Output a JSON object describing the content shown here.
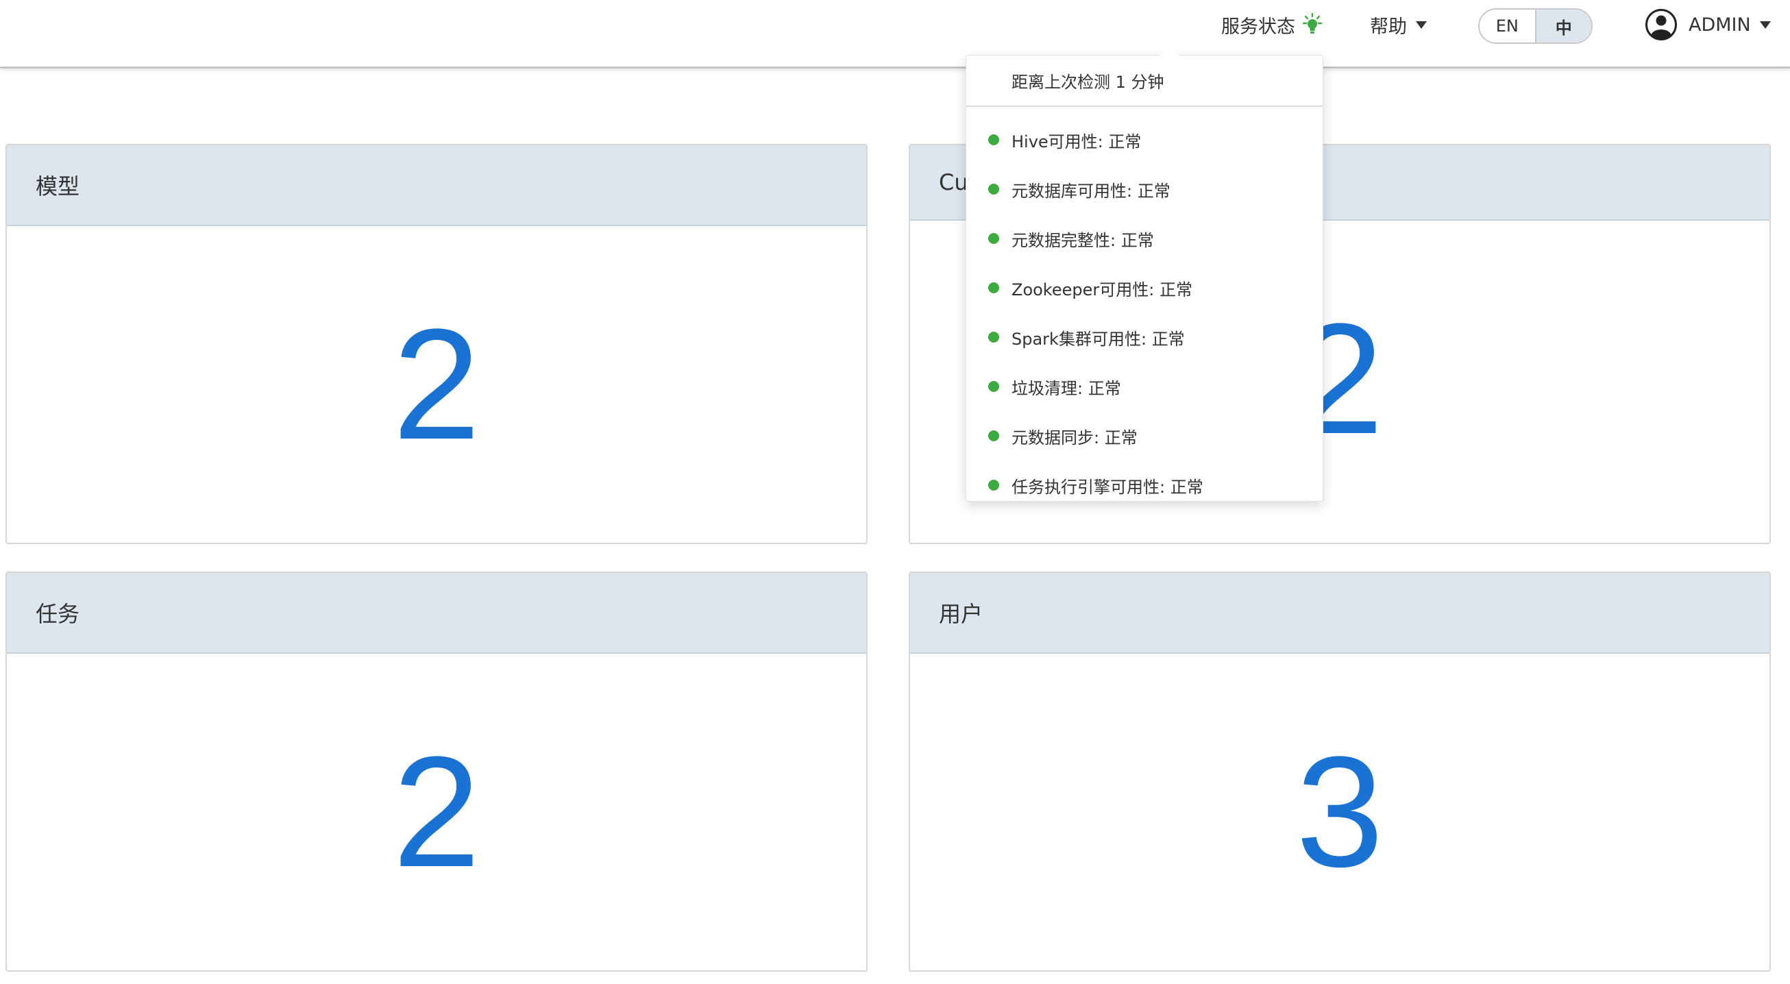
{
  "header": {
    "service_status_label": "服务状态",
    "help_label": "帮助",
    "lang": {
      "en": "EN",
      "zh": "中",
      "selected": "中"
    },
    "user_name": "ADMIN",
    "status_color": "#3bac3f"
  },
  "status_dropdown": {
    "last_check": "距离上次检测 1 分钟",
    "items": [
      {
        "text": "Hive可用性: 正常"
      },
      {
        "text": "元数据库可用性: 正常"
      },
      {
        "text": "元数据完整性: 正常"
      },
      {
        "text": "Zookeeper可用性: 正常"
      },
      {
        "text": "Spark集群可用性: 正常"
      },
      {
        "text": "垃圾清理: 正常"
      },
      {
        "text": "元数据同步: 正常"
      },
      {
        "text": "任务执行引擎可用性: 正常"
      }
    ]
  },
  "cards": [
    {
      "title": "模型",
      "value": "2"
    },
    {
      "title": "Cu",
      "value": "2"
    },
    {
      "title": "任务",
      "value": "2"
    },
    {
      "title": "用户",
      "value": "3"
    }
  ],
  "colors": {
    "accent_blue": "#1a73d4",
    "card_header_bg": "#dde6ee"
  }
}
